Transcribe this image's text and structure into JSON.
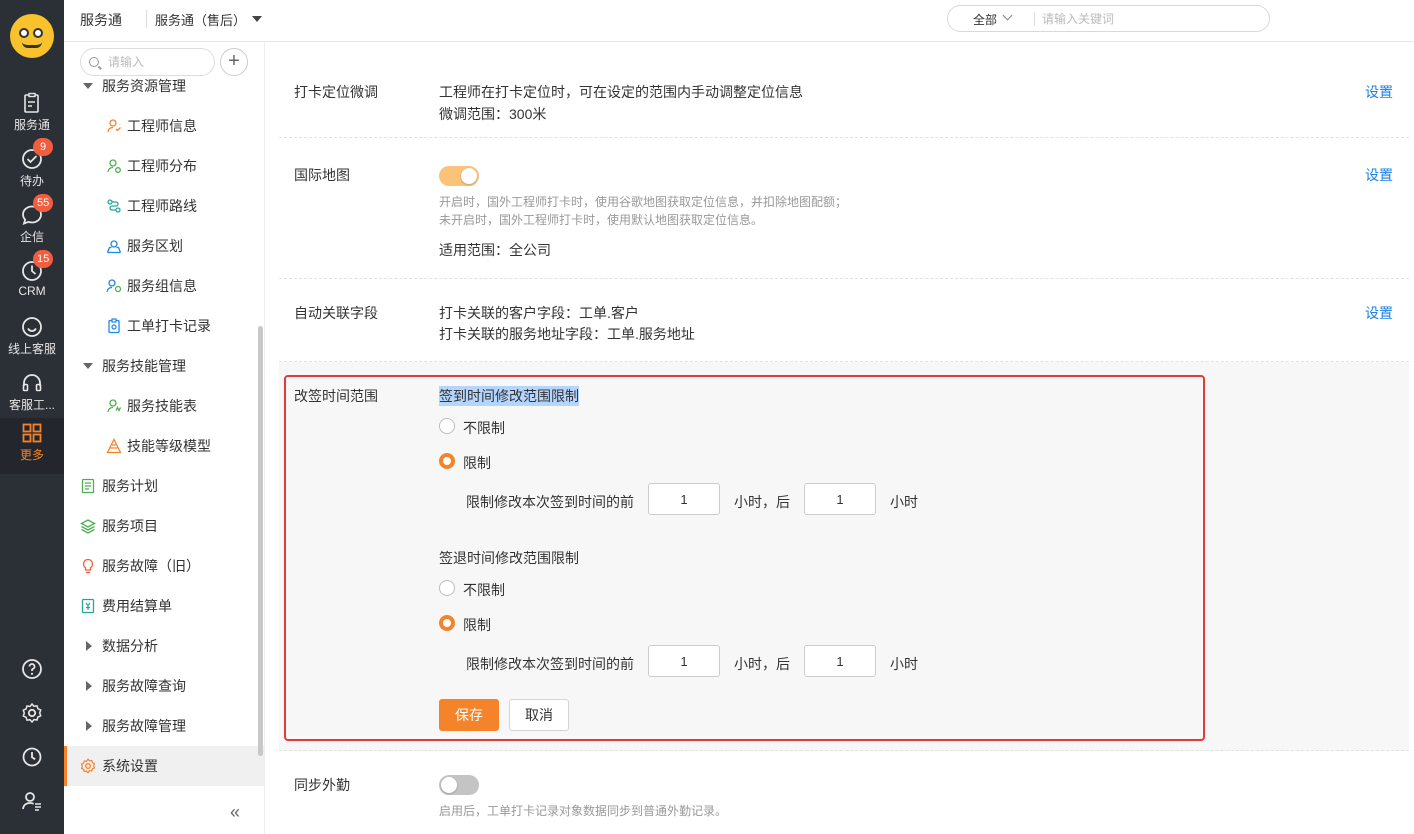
{
  "rail": {
    "items": [
      {
        "label": "服务通",
        "icon": "clipboard-icon"
      },
      {
        "label": "待办",
        "icon": "check-circle-icon",
        "badge": "9"
      },
      {
        "label": "企信",
        "icon": "chat-bubble-icon",
        "badge": "55"
      },
      {
        "label": "CRM",
        "icon": "clock-icon",
        "badge": "15"
      },
      {
        "label": "线上客服",
        "icon": "smile-icon"
      },
      {
        "label": "客服工...",
        "icon": "headset-icon"
      },
      {
        "label": "更多",
        "icon": "grid-icon"
      }
    ],
    "bottom_icons": [
      "help-icon",
      "settings-icon",
      "history-icon",
      "user-manage-icon"
    ],
    "accent": "#f5832a"
  },
  "topbar": {
    "app_name": "服务通",
    "app_switch": "服务通（售后）",
    "search_scope": "全部",
    "search_placeholder": "请输入关键词"
  },
  "sidebar": {
    "search_placeholder": "请输入",
    "add_label": "+",
    "items": [
      {
        "label": "服务资源管理",
        "icon": "triangle-down-icon"
      },
      {
        "label": "工程师信息",
        "icon": "engineer-info-icon"
      },
      {
        "label": "工程师分布",
        "icon": "engineer-distribution-icon"
      },
      {
        "label": "工程师路线",
        "icon": "engineer-route-icon"
      },
      {
        "label": "服务区划",
        "icon": "service-area-icon"
      },
      {
        "label": "服务组信息",
        "icon": "service-group-icon"
      },
      {
        "label": "工单打卡记录",
        "icon": "checkin-record-icon"
      },
      {
        "label": "服务技能管理",
        "icon": "triangle-down-icon"
      },
      {
        "label": "服务技能表",
        "icon": "skill-table-icon"
      },
      {
        "label": "技能等级模型",
        "icon": "skill-level-icon"
      },
      {
        "label": "服务计划",
        "icon": "service-plan-icon"
      },
      {
        "label": "服务项目",
        "icon": "service-project-icon"
      },
      {
        "label": "服务故障（旧）",
        "icon": "bulb-icon"
      },
      {
        "label": "费用结算单",
        "icon": "receipt-icon"
      },
      {
        "label": "数据分析",
        "icon": "triangle-right-icon"
      },
      {
        "label": "服务故障查询",
        "icon": "triangle-right-icon"
      },
      {
        "label": "服务故障管理",
        "icon": "triangle-right-icon"
      },
      {
        "label": "系统设置",
        "icon": "gear-icon"
      }
    ],
    "collapse_label": "«"
  },
  "main": {
    "row1": {
      "label": "打卡定位微调",
      "line1": "工程师在打卡定位时，可在设定的范围内手动调整定位信息",
      "line2": "微调范围：300米",
      "link": "设置"
    },
    "row2": {
      "label": "国际地图",
      "toggle_on": true,
      "hint1": "开启时，国外工程师打卡时，使用谷歌地图获取定位信息，并扣除地图配额；",
      "hint2": "未开启时，国外工程师打卡时，使用默认地图获取定位信息。",
      "scope": "适用范围：全公司",
      "link": "设置"
    },
    "row3": {
      "label": "自动关联字段",
      "line1": "打卡关联的客户字段：工单.客户",
      "line2": "打卡关联的服务地址字段：工单.服务地址",
      "link": "设置"
    },
    "row4": {
      "label": "改签时间范围",
      "checkin": {
        "title": "签到时间修改范围限制",
        "opt_unlimited": "不限制",
        "opt_limited": "限制",
        "selected": "限制",
        "prefix": "限制修改本次签到时间的前",
        "before_value": "1",
        "middle": "小时，后",
        "after_value": "1",
        "suffix": "小时"
      },
      "checkout": {
        "title": "签退时间修改范围限制",
        "opt_unlimited": "不限制",
        "opt_limited": "限制",
        "selected": "限制",
        "prefix": "限制修改本次签到时间的前",
        "before_value": "1",
        "middle": "小时，后",
        "after_value": "1",
        "suffix": "小时"
      },
      "save_label": "保存",
      "cancel_label": "取消"
    },
    "row5": {
      "label": "同步外勤",
      "toggle_on": false,
      "hint": "启用后，工单打卡记录对象数据同步到普通外勤记录。"
    }
  }
}
